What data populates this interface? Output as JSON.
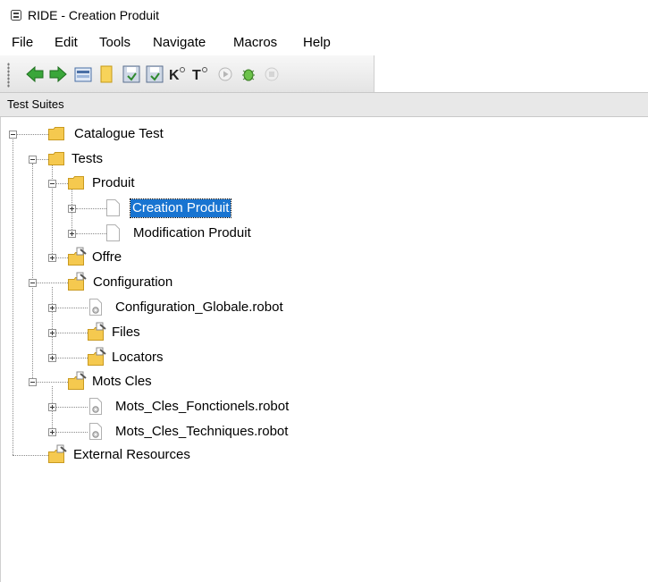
{
  "window": {
    "title": "RIDE - Creation Produit",
    "icon": "ride-app-icon"
  },
  "menu": [
    "File",
    "Edit",
    "Tools",
    "Navigate",
    "Macros",
    "Help"
  ],
  "toolbar": {
    "buttons": [
      "back-arrow-icon",
      "forward-arrow-icon",
      "open-folder-icon",
      "open-directory-icon",
      "save-icon",
      "save-all-icon",
      "search-keywords-icon",
      "search-tests-icon",
      "run-icon",
      "debug-icon",
      "stop-icon"
    ]
  },
  "panel": {
    "title": "Test Suites"
  },
  "tree": {
    "catalogue": "Catalogue Test",
    "tests": "Tests",
    "produit": "Produit",
    "creation": "Creation Produit",
    "modification": "Modification Produit",
    "offre": "Offre",
    "configuration": "Configuration",
    "config_globale": "Configuration_Globale.robot",
    "files": "Files",
    "locators": "Locators",
    "mots_cles": "Mots Cles",
    "fonctionels": "Mots_Cles_Fonctionels.robot",
    "techniques": "Mots_Cles_Techniques.robot",
    "external": "External Resources"
  },
  "selected_item": "Creation Produit",
  "colors": {
    "selection": "#1874d1",
    "folder": "#f5c94f",
    "toolbar_bg": "#ececec"
  }
}
